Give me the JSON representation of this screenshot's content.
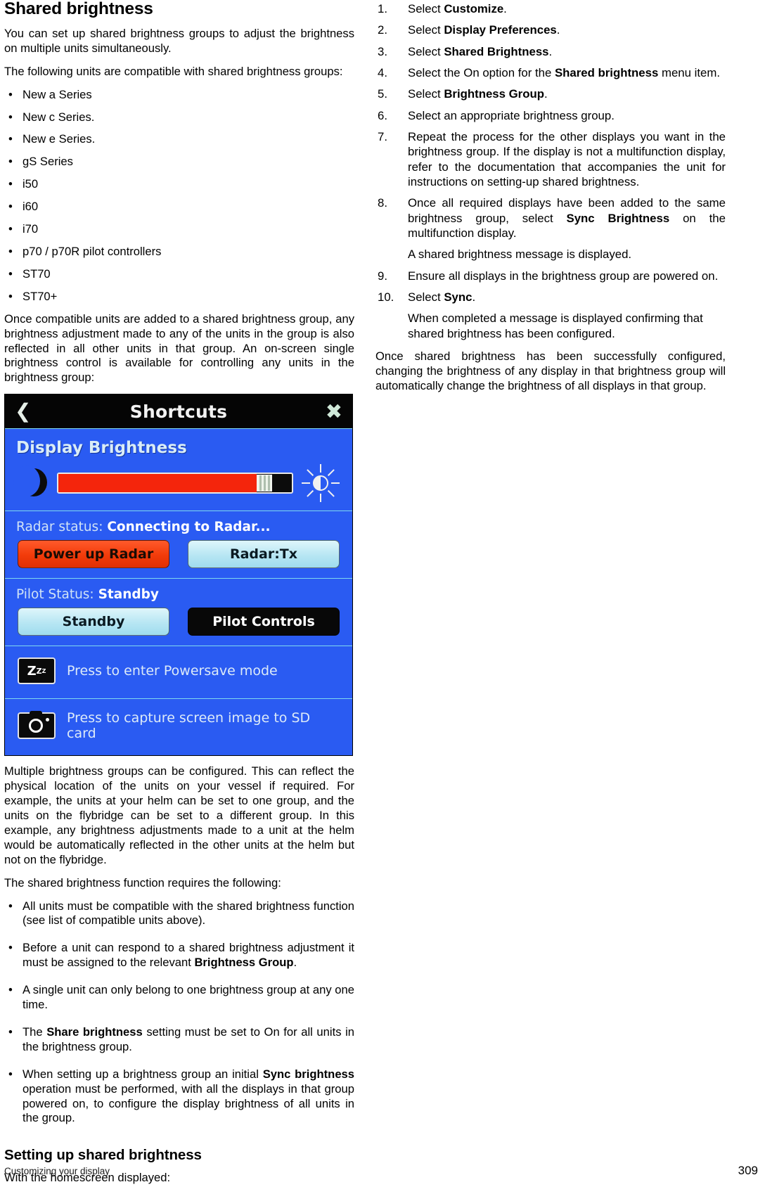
{
  "left": {
    "title": "Shared brightness",
    "intro1": "You can set up shared brightness groups to adjust the brightness on multiple units simultaneously.",
    "intro2": "The following units are compatible with shared brightness groups:",
    "compatible_units": [
      "New a Series",
      "New c Series.",
      "New e Series.",
      "gS Series",
      "i50",
      "i60",
      "i70",
      "p70 / p70R pilot controllers",
      "ST70",
      "ST70+"
    ],
    "after_list": "Once compatible units are added to a shared brightness group, any brightness adjustment made to any of the units in the group is also reflected in all other units in that group. An on-screen single brightness control is available for controlling any units in the brightness group:",
    "after_image": "Multiple brightness groups can be configured. This can reflect the physical location of the units on your vessel if required. For example, the units at your helm can be set to one group, and the units on the flybridge can be set to a different group. In this example, any brightness adjustments made to a unit at the helm would be automatically reflected in the other units at the helm but not on the flybridge.",
    "requires_intro": "The shared brightness function requires the following:",
    "requirements": [
      {
        "pre": "All units must be compatible with the shared brightness function (see list of compatible units above).",
        "bold": "",
        "post": ""
      },
      {
        "pre": "Before a unit can respond to a shared brightness adjustment it must be assigned to the relevant ",
        "bold": "Brightness Group",
        "post": "."
      },
      {
        "pre": "A single unit can only belong to one brightness group at any one time.",
        "bold": "",
        "post": ""
      },
      {
        "pre": "The ",
        "bold": "Share brightness",
        "post": " setting must be set to On for all units in the brightness group."
      },
      {
        "pre": "When setting up a brightness group an initial ",
        "bold": "Sync brightness",
        "post": " operation must be performed, with all the displays in that group powered on, to configure the display brightness of all units in the group."
      }
    ],
    "setup_title": "Setting up shared brightness",
    "setup_intro": "With the homescreen displayed:"
  },
  "device_screenshot": {
    "titlebar": {
      "back_icon": "chevron-left-icon",
      "title": "Shortcuts",
      "close_icon": "close-x-icon"
    },
    "brightness": {
      "heading": "Display Brightness",
      "low_icon": "moon-icon",
      "high_icon": "sun-icon",
      "value_percent": 85
    },
    "radar": {
      "status_label": "Radar status:",
      "status_value": "Connecting to Radar...",
      "button_power": "Power up Radar",
      "button_tx": "Radar:Tx"
    },
    "pilot": {
      "status_label": "Pilot Status:",
      "status_value": "Standby",
      "button_standby": "Standby",
      "button_controls": "Pilot Controls"
    },
    "powersave": {
      "icon": "zzz-icon",
      "label": "Press to enter Powersave mode"
    },
    "capture": {
      "icon": "camera-icon",
      "label": "Press to capture screen image to SD card"
    },
    "colors": {
      "panel_blue": "#2a5bf2",
      "titlebar_black": "#050505",
      "slider_red": "#f4250c",
      "button_cyan": "#b7e6f3"
    }
  },
  "right": {
    "steps": [
      {
        "pre": "Select ",
        "bold": "Customize",
        "post": ".",
        "note": ""
      },
      {
        "pre": "Select ",
        "bold": "Display Preferences",
        "post": ".",
        "note": ""
      },
      {
        "pre": "Select ",
        "bold": "Shared Brightness",
        "post": ".",
        "note": ""
      },
      {
        "pre": "Select the On option for the ",
        "bold": "Shared brightness",
        "post": " menu item.",
        "note": ""
      },
      {
        "pre": "Select ",
        "bold": "Brightness Group",
        "post": ".",
        "note": ""
      },
      {
        "pre": "Select an appropriate brightness group.",
        "bold": "",
        "post": "",
        "note": ""
      },
      {
        "pre": "Repeat the process for the other displays you want in the brightness group. If the display is not a multifunction display, refer to the documentation that accompanies the unit for instructions on setting-up shared brightness.",
        "bold": "",
        "post": "",
        "note": ""
      },
      {
        "pre": "Once all required displays have been added to the same brightness group, select ",
        "bold": "Sync Brightness",
        "post": " on the multifunction display.",
        "note": "A shared brightness message is displayed."
      },
      {
        "pre": "Ensure all displays in the brightness group are powered on.",
        "bold": "",
        "post": "",
        "note": ""
      },
      {
        "pre": "Select ",
        "bold": "Sync",
        "post": ".",
        "note": "When completed a message is displayed confirming that shared brightness has been configured."
      }
    ],
    "closing": "Once shared brightness has been successfully configured, changing the brightness of any display in that brightness group will automatically change the brightness of all displays in that group."
  },
  "footer": {
    "chapter": "Customizing your display",
    "page_number": "309"
  }
}
